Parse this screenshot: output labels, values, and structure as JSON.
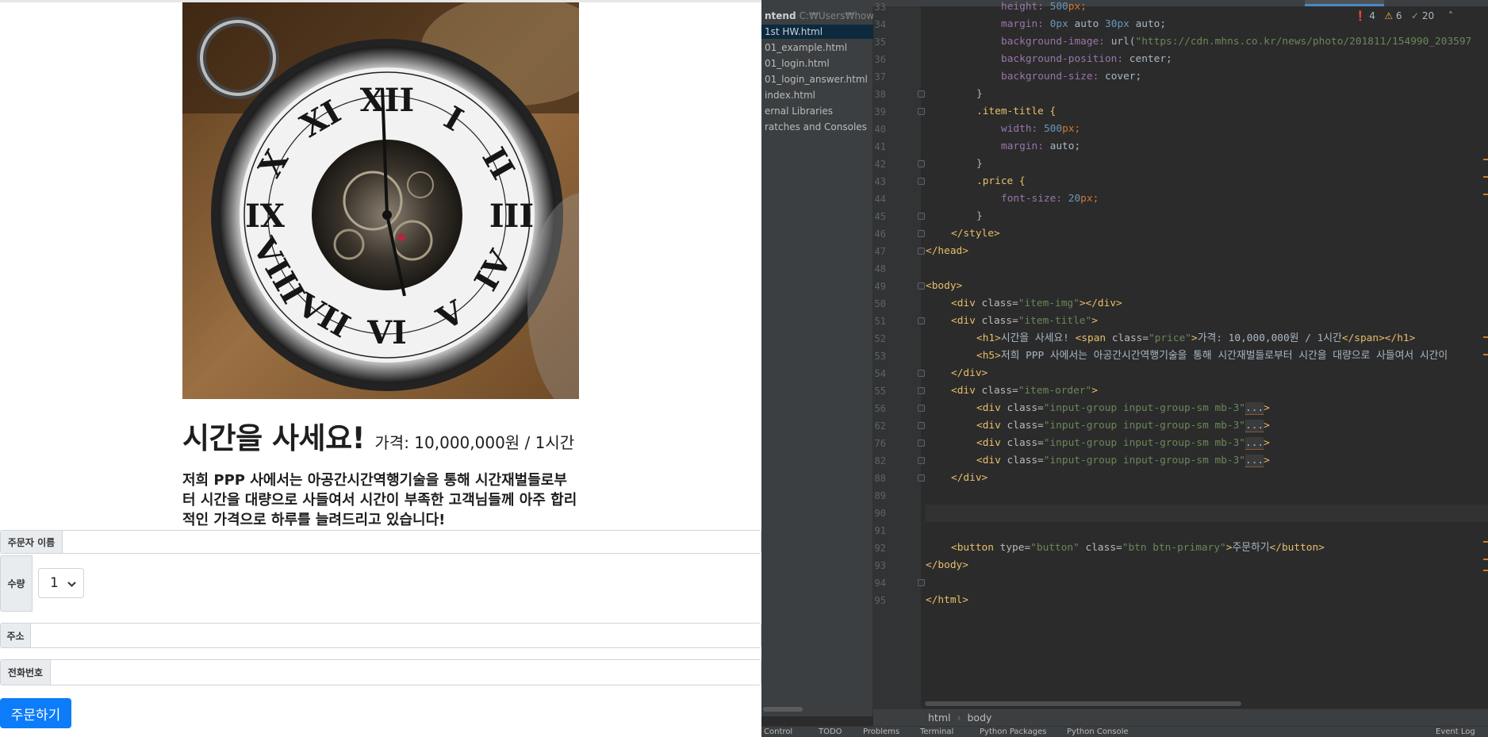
{
  "browser": {
    "title": "시간을 사세요!",
    "price": "가격: 10,000,000원 / 1시간",
    "description": "저희 PPP 사에서는 아공간시간역행기술을 통해 시간재벌들로부터 시간을 대량으로 사들여서 시간이 부족한 고객님들께 아주 합리적인 가격으로 하루를 늘려드리고 있습니다!",
    "form": {
      "name_label": "주문자 이름",
      "qty_label": "수량",
      "qty_value": "1",
      "address_label": "주소",
      "phone_label": "전화번호"
    },
    "order_button": "주문하기"
  },
  "ide": {
    "project_root": "ntend",
    "project_path": "C:₩Users₩hower₩",
    "files": [
      "1st HW.html",
      "01_example.html",
      "01_login.html",
      "01_login_answer.html",
      "index.html"
    ],
    "other_nodes": [
      "ernal Libraries",
      "ratches and Consoles"
    ],
    "indicators": {
      "errors": "4",
      "warnings": "6",
      "ok": "20"
    },
    "line_numbers": [
      "33",
      "34",
      "35",
      "36",
      "37",
      "38",
      "39",
      "40",
      "41",
      "42",
      "43",
      "44",
      "45",
      "46",
      "47",
      "48",
      "49",
      "50",
      "51",
      "52",
      "53",
      "54",
      "55",
      "56",
      "62",
      "76",
      "82",
      "88",
      "89",
      "90",
      "91",
      "92",
      "93",
      "94",
      "95"
    ],
    "code": {
      "l33": [
        "height: ",
        "500",
        "px;"
      ],
      "l34": [
        "margin: ",
        "0",
        "px",
        " auto ",
        "30",
        "px",
        " auto;"
      ],
      "l35": [
        "background-image: ",
        "url(",
        "\"https://cdn.mhns.co.kr/news/photo/201811/154990_203597"
      ],
      "l36": [
        "background-position: ",
        "center;"
      ],
      "l37": [
        "background-size: ",
        "cover;"
      ],
      "l38": "}",
      "l39": ".item-title {",
      "l40": [
        "width: ",
        "500",
        "px;"
      ],
      "l41": [
        "margin: ",
        "auto;"
      ],
      "l42": "}",
      "l43": ".price {",
      "l44": [
        "font-size: ",
        "20",
        "px;"
      ],
      "l45": "}",
      "l46": "</style>",
      "l47": "</head>",
      "l49": "<body>",
      "l50": [
        "<div ",
        "class=",
        "\"item-img\"",
        "></div>"
      ],
      "l51": [
        "<div ",
        "class=",
        "\"item-title\"",
        ">"
      ],
      "l52": [
        "<h1>",
        "시간을 사세요! ",
        "<span ",
        "class=",
        "\"price\"",
        ">",
        "가격: 10,000,000원 / 1시간",
        "</span></h1>"
      ],
      "l53": [
        "<h5>",
        "저희 PPP 사에서는 아공간시간역행기술을 통해 시간재벌들로부터 시간을 대량으로 사들여서 시간이"
      ],
      "l54": "</div>",
      "l55": [
        "<div ",
        "class=",
        "\"item-order\"",
        ">"
      ],
      "l56": [
        "<div ",
        "class=",
        "\"input-group input-group-sm mb-3\"",
        "...",
        ">"
      ],
      "l92": [
        "<button ",
        "type=",
        "\"button\"",
        " class=",
        "\"btn btn-primary\"",
        ">",
        "주문하기",
        "</button>"
      ],
      "l93": "</body>",
      "l95": "</html>"
    },
    "breadcrumbs": [
      "html",
      "body"
    ],
    "statusbar": [
      "Control",
      "TODO",
      "Problems",
      "Terminal",
      "Python Packages",
      "Python Console",
      "Event Log"
    ]
  }
}
